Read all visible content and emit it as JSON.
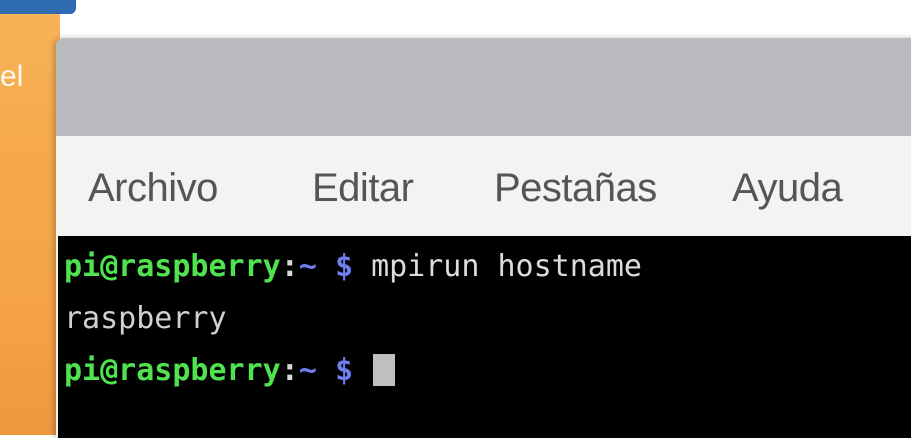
{
  "desktop": {
    "fragment_text": "el",
    "wallpaper_color": "#f5a346",
    "panel_color": "#2f6bb0"
  },
  "window": {
    "titlebar_color": "#b9bbbe",
    "menu": [
      {
        "label": "Archivo"
      },
      {
        "label": "Editar"
      },
      {
        "label": "Pestañas"
      },
      {
        "label": "Ayuda"
      }
    ]
  },
  "terminal": {
    "background": "#000000",
    "lines": [
      {
        "user_host": "pi@raspberry",
        "separator": ":",
        "path": "~",
        "prompt_symbol": "$",
        "command": "mpirun hostname"
      },
      {
        "output": "raspberry"
      },
      {
        "user_host": "pi@raspberry",
        "separator": ":",
        "path": "~",
        "prompt_symbol": "$",
        "command": ""
      }
    ],
    "colors": {
      "user_host": "#4fe34f",
      "path": "#6f7dee",
      "text": "#d8d8d8",
      "cursor": "#bfbfbf"
    }
  }
}
